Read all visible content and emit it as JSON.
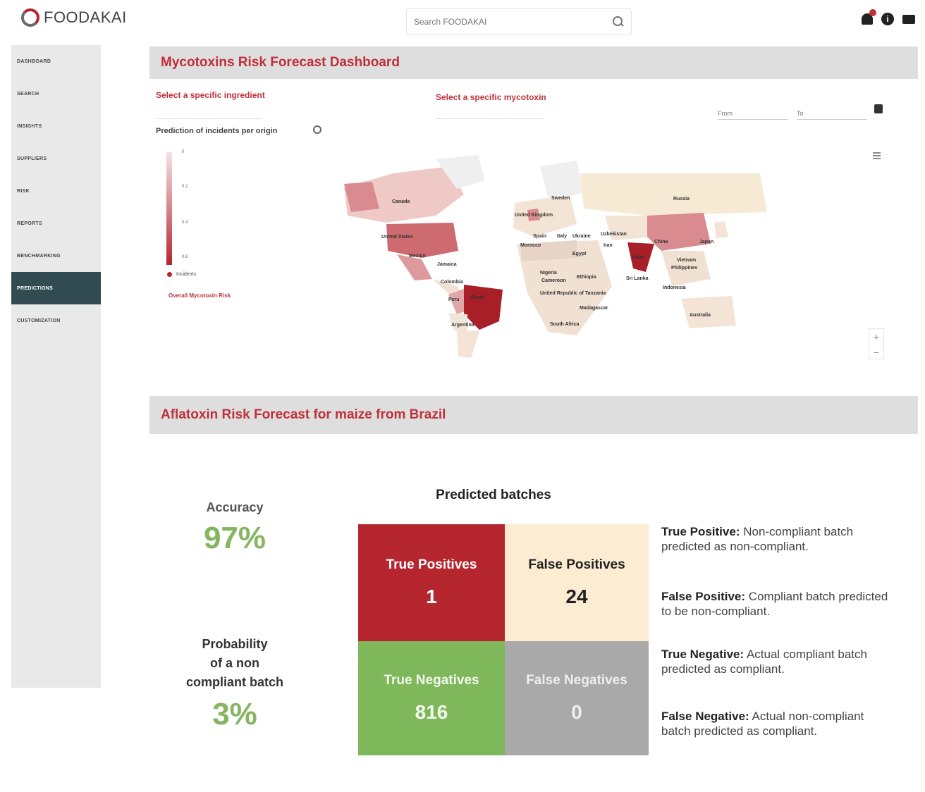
{
  "header": {
    "logo_text": "FOODAKAI",
    "search_placeholder": "Search FOODAKAI"
  },
  "sidebar": {
    "items": [
      {
        "label": "DASHBOARD"
      },
      {
        "label": "SEARCH"
      },
      {
        "label": "INSIGHTS"
      },
      {
        "label": "SUPPLIERS"
      },
      {
        "label": "RISK"
      },
      {
        "label": "REPORTS"
      },
      {
        "label": "BENCHMARKING"
      },
      {
        "label": "PREDICTIONS",
        "active": true
      },
      {
        "label": "CUSTOMIZATION"
      }
    ]
  },
  "dashboard": {
    "title": "Mycotoxins Risk Forecast Dashboard",
    "ingredient_label": "Select a specific ingredient",
    "mycotoxin_label": "Select a specific mycotoxin",
    "from_label": "From",
    "to_label": "To",
    "prediction_label": "Prediction of incidents per origin",
    "legend_ticks": [
      "0",
      "0.2",
      "0.4",
      "0.6"
    ],
    "legend_dot_label": "Incidents",
    "overall_label": "Overall Mycotoxin Risk",
    "zoom_in": "+",
    "zoom_out": "−",
    "countries": [
      "Canada",
      "Sweden",
      "Russia",
      "United Kingdom",
      "Spain",
      "Italy",
      "Ukraine",
      "Uzbekistan",
      "United States",
      "Morocco",
      "Egypt",
      "Iran",
      "China",
      "Japan",
      "India",
      "Mexico",
      "Jamaica",
      "Vietnam",
      "Philippines",
      "Colombia",
      "Nigeria",
      "Ethiopia",
      "Sri Lanka",
      "Peru",
      "Brazil",
      "Cameroon",
      "United Republic of Tanzania",
      "Indonesia",
      "Madagascar",
      "Argentina",
      "South Africa",
      "Australia"
    ]
  },
  "forecast": {
    "title": "Aflatoxin Risk Forecast for maize from  Brazil",
    "accuracy_label": "Accuracy",
    "accuracy_value": "97%",
    "probability_label_lines": [
      "Probability",
      "of a non",
      "compliant batch"
    ],
    "probability_value": "3%",
    "predicted_title": "Predicted batches",
    "matrix": {
      "tp_label": "True Positives",
      "tp_value": "1",
      "fp_label": "False Positives",
      "fp_value": "24",
      "tn_label": "True Negatives",
      "tn_value": "816",
      "fn_label": "False Negatives",
      "fn_value": "0"
    },
    "definitions": [
      {
        "term": "True Positive:",
        "text": " Non-compliant batch predicted as non-compliant."
      },
      {
        "term": "False Positive:",
        "text": " Compliant batch predicted to be non-compliant."
      },
      {
        "term": "True Negative:",
        "text": " Actual compliant batch predicted as compliant."
      },
      {
        "term": "False Negative:",
        "text": " Actual non-compliant batch predicted as compliant."
      }
    ]
  },
  "colors": {
    "accent_red": "#c0303a",
    "true_positive": "#b5262f",
    "false_positive": "#fbecd2",
    "true_negative": "#7fb75b",
    "false_negative": "#a9a9a9",
    "sidebar_active": "#324a52"
  }
}
